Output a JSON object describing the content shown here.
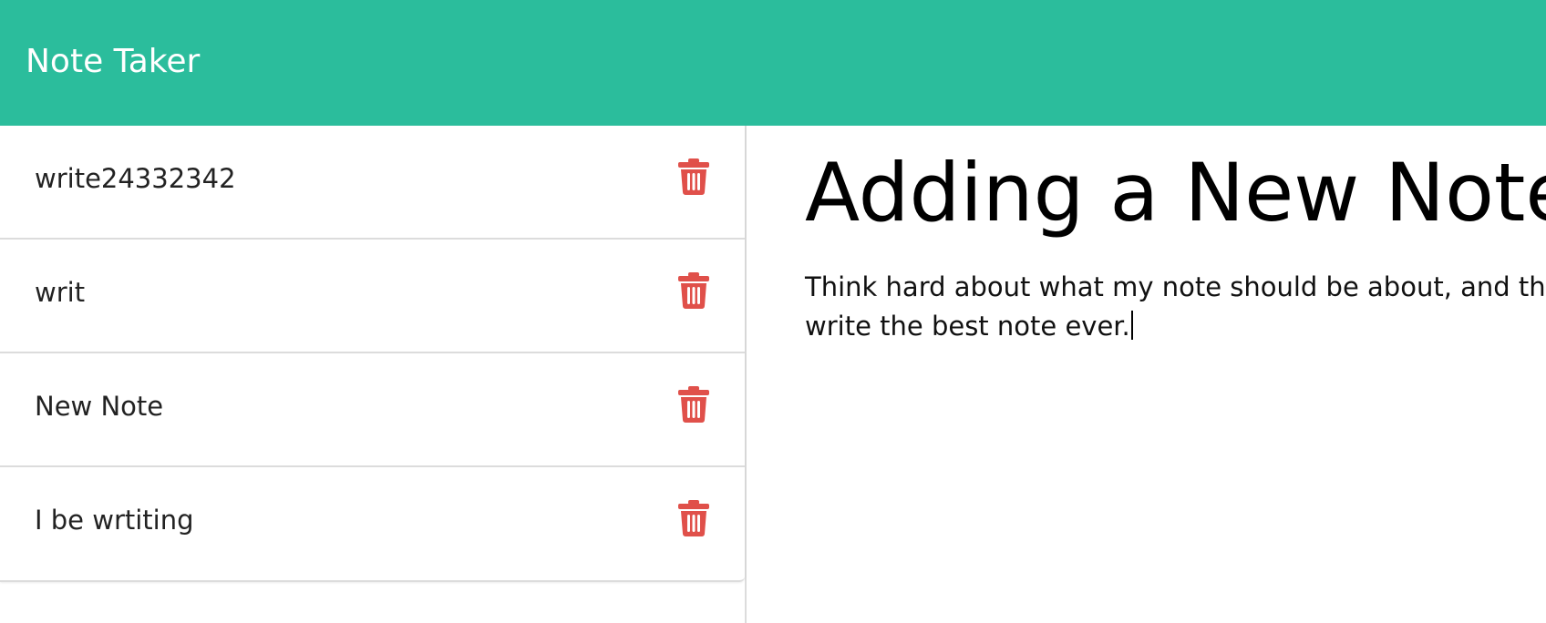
{
  "app": {
    "brand": "Note Taker"
  },
  "colors": {
    "navbar": "#2bbd9c",
    "trash_icon": "#e0504a",
    "divider": "#dcdcdc"
  },
  "notes": [
    {
      "title": "write24332342",
      "icon": "trash-icon"
    },
    {
      "title": "writ",
      "icon": "trash-icon"
    },
    {
      "title": "New Note",
      "icon": "trash-icon"
    },
    {
      "title": "I be wrtiting",
      "icon": "trash-icon"
    }
  ],
  "editor": {
    "title": "Adding a New Note",
    "body": "Think hard about what my note should be about, and then write the best note ever."
  }
}
